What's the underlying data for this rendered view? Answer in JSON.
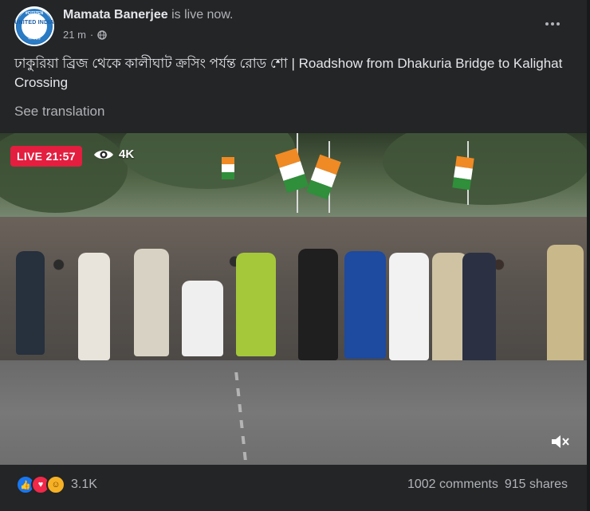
{
  "post": {
    "author": "Mamata Banerjee",
    "status_suffix": "is live now.",
    "time": "21 m",
    "separator": "·",
    "privacy_icon": "globe-icon",
    "text": "ঢাকুরিয়া ব্রিজ থেকে কালীঘাট ক্রসিং পর্যন্ত রোড শো | Roadshow from Dhakuria Bridge to Kalighat Crossing",
    "see_translation": "See translation",
    "more_icon": "more-horizontal-icon"
  },
  "avatar": {
    "top_text": "#CITIZEN",
    "middle_text": "UNITED INDIA",
    "bottom_text": "নাগরিক"
  },
  "video": {
    "live_label": "LIVE 21:57",
    "viewer_count": "4K",
    "viewer_icon": "eye-icon",
    "mute_icon": "speaker-muted-icon"
  },
  "footer": {
    "reaction_icons": [
      "like-icon",
      "love-icon",
      "haha-icon"
    ],
    "reaction_count": "3.1K",
    "comments": "1002 comments",
    "shares": "915 shares"
  },
  "colors": {
    "background": "#242526",
    "text_primary": "#e4e6eb",
    "text_secondary": "#b0b3b8",
    "live_red": "#e41e3f",
    "like_blue": "#1877f2",
    "love_red": "#f02849",
    "haha_yellow": "#f7b125"
  }
}
